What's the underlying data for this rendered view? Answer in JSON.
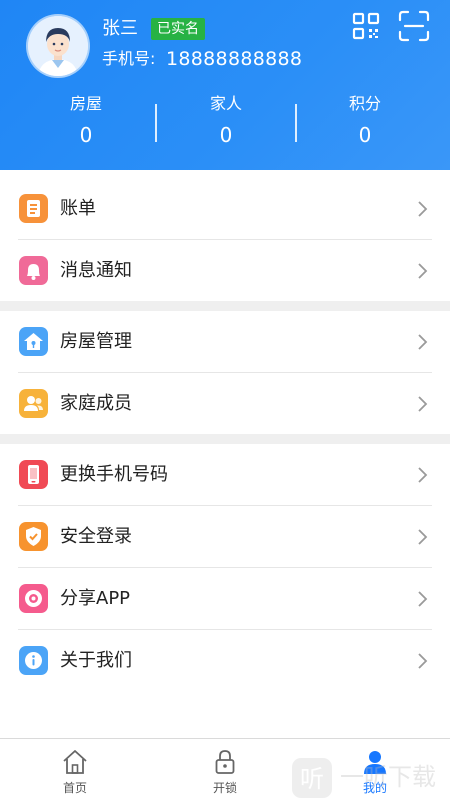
{
  "profile": {
    "name": "张三",
    "verified_badge": "已实名",
    "phone_label": "手机号:",
    "phone": "18888888888"
  },
  "stats": [
    {
      "label": "房屋",
      "value": "0"
    },
    {
      "label": "家人",
      "value": "0"
    },
    {
      "label": "积分",
      "value": "0"
    }
  ],
  "menu": {
    "bill": {
      "label": "账单",
      "icon": "bill-icon",
      "color": "#f7923a"
    },
    "notify": {
      "label": "消息通知",
      "icon": "bell-icon",
      "color": "#f06a98"
    },
    "house": {
      "label": "房屋管理",
      "icon": "house-icon",
      "color": "#4ba4f7"
    },
    "family": {
      "label": "家庭成员",
      "icon": "family-icon",
      "color": "#f7b23a"
    },
    "phone": {
      "label": "更换手机号码",
      "icon": "phone-icon",
      "color": "#f04a55"
    },
    "security": {
      "label": "安全登录",
      "icon": "shield-icon",
      "color": "#f7932e"
    },
    "share": {
      "label": "分享APP",
      "icon": "share-icon",
      "color": "#f55b8d"
    },
    "about": {
      "label": "关于我们",
      "icon": "info-icon",
      "color": "#4ba4f7"
    }
  },
  "nav": [
    {
      "label": "首页",
      "icon": "home-icon"
    },
    {
      "label": "开锁",
      "icon": "lock-icon"
    },
    {
      "label": "我的",
      "icon": "user-icon",
      "active": true
    }
  ],
  "watermark": {
    "text": "一听下载"
  },
  "colors": {
    "primary": "#1f86f5",
    "badge": "#27b244",
    "active_nav": "#1677ff"
  }
}
